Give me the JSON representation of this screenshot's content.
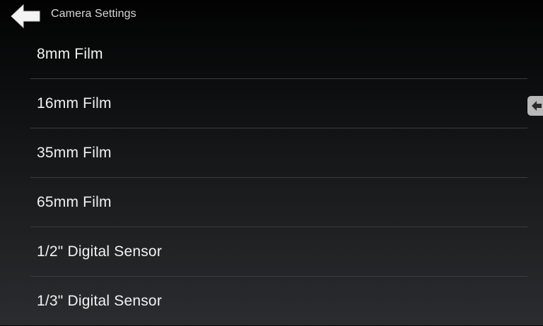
{
  "header": {
    "title": "Camera Settings",
    "back_icon": "arrow-left-icon"
  },
  "options": [
    {
      "label": "8mm Film"
    },
    {
      "label": "16mm Film"
    },
    {
      "label": "35mm Film"
    },
    {
      "label": "65mm Film"
    },
    {
      "label": "1/2\" Digital Sensor"
    },
    {
      "label": "1/3\" Digital Sensor"
    }
  ],
  "side_handle": {
    "icon": "arrow-left-icon"
  },
  "colors": {
    "background_top": "#020202",
    "background_bottom": "#2a2c2f",
    "divider": "#3a3c3f",
    "text": "#f2f2f2"
  }
}
